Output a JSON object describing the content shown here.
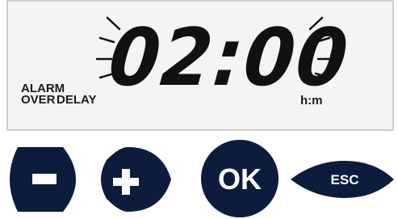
{
  "display": {
    "time": "02:00",
    "unit": "h:m",
    "labels": {
      "alarm": "ALARM",
      "over": "OVER",
      "delay": "DELAY"
    },
    "blinking": true
  },
  "buttons": {
    "minus": {
      "icon": "minus-icon"
    },
    "plus": {
      "icon": "plus-icon"
    },
    "ok": {
      "label": "OK"
    },
    "esc": {
      "label": "ESC"
    }
  },
  "colors": {
    "button": "#0d1b3d",
    "button_text": "#ffffff",
    "lcd_background": "#f4f4f4",
    "segment": "#111111"
  }
}
